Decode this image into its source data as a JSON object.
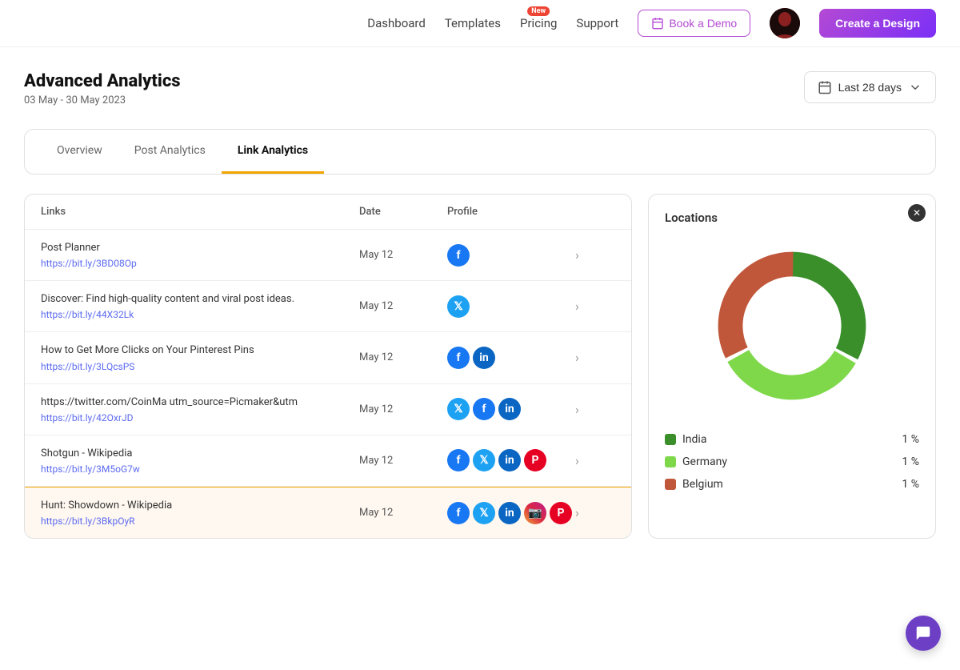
{
  "nav": {
    "links": [
      {
        "id": "dashboard",
        "label": "Dashboard",
        "new": false
      },
      {
        "id": "templates",
        "label": "Templates",
        "new": false
      },
      {
        "id": "pricing",
        "label": "Pricing",
        "new": true
      },
      {
        "id": "support",
        "label": "Support",
        "new": false
      }
    ],
    "book_demo": "Book a Demo",
    "create_design": "Create a Design"
  },
  "page": {
    "title": "Advanced Analytics",
    "date_range": "03 May - 30 May 2023",
    "date_selector": "Last 28 days"
  },
  "tabs": [
    {
      "id": "overview",
      "label": "Overview",
      "active": false
    },
    {
      "id": "post_analytics",
      "label": "Post Analytics",
      "active": false
    },
    {
      "id": "link_analytics",
      "label": "Link Analytics",
      "active": true
    }
  ],
  "table": {
    "headers": [
      "Links",
      "Date",
      "Profile",
      ""
    ],
    "rows": [
      {
        "id": "row1",
        "title": "Post Planner",
        "url": "https://bit.ly/3BD08Op",
        "date": "May 12",
        "profiles": [
          "fb"
        ],
        "selected": false
      },
      {
        "id": "row2",
        "title": "Discover: Find high-quality content and viral post ideas.",
        "url": "https://bit.ly/44X32Lk",
        "date": "May 12",
        "profiles": [
          "tw"
        ],
        "selected": false
      },
      {
        "id": "row3",
        "title": "How to Get More Clicks on Your Pinterest Pins",
        "url": "https://bit.ly/3LQcsPS",
        "date": "May 12",
        "profiles": [
          "fb",
          "li"
        ],
        "selected": false
      },
      {
        "id": "row4",
        "title": "https://twitter.com/CoinMa utm_source=Picmaker&utm",
        "url": "https://bit.ly/42OxrJD",
        "date": "May 12",
        "profiles": [
          "tw",
          "fb",
          "li"
        ],
        "selected": false
      },
      {
        "id": "row5",
        "title": "Shotgun - Wikipedia",
        "url": "https://bit.ly/3M5oG7w",
        "date": "May 12",
        "profiles": [
          "fb",
          "tw",
          "li",
          "pi"
        ],
        "selected": false
      },
      {
        "id": "row6",
        "title": "Hunt: Showdown - Wikipedia",
        "url": "https://bit.ly/3BkpOyR",
        "date": "May 12",
        "profiles": [
          "fb",
          "tw",
          "li",
          "ig",
          "pi"
        ],
        "selected": true
      }
    ]
  },
  "locations": {
    "title": "Locations",
    "legend": [
      {
        "label": "India",
        "color": "#3a8f2a",
        "value": "1 %"
      },
      {
        "label": "Germany",
        "color": "#7ed84a",
        "value": "1 %"
      },
      {
        "label": "Belgium",
        "color": "#c0573a",
        "value": "1 %"
      }
    ],
    "donut": {
      "india_pct": 33,
      "germany_pct": 34,
      "belgium_pct": 33
    }
  }
}
